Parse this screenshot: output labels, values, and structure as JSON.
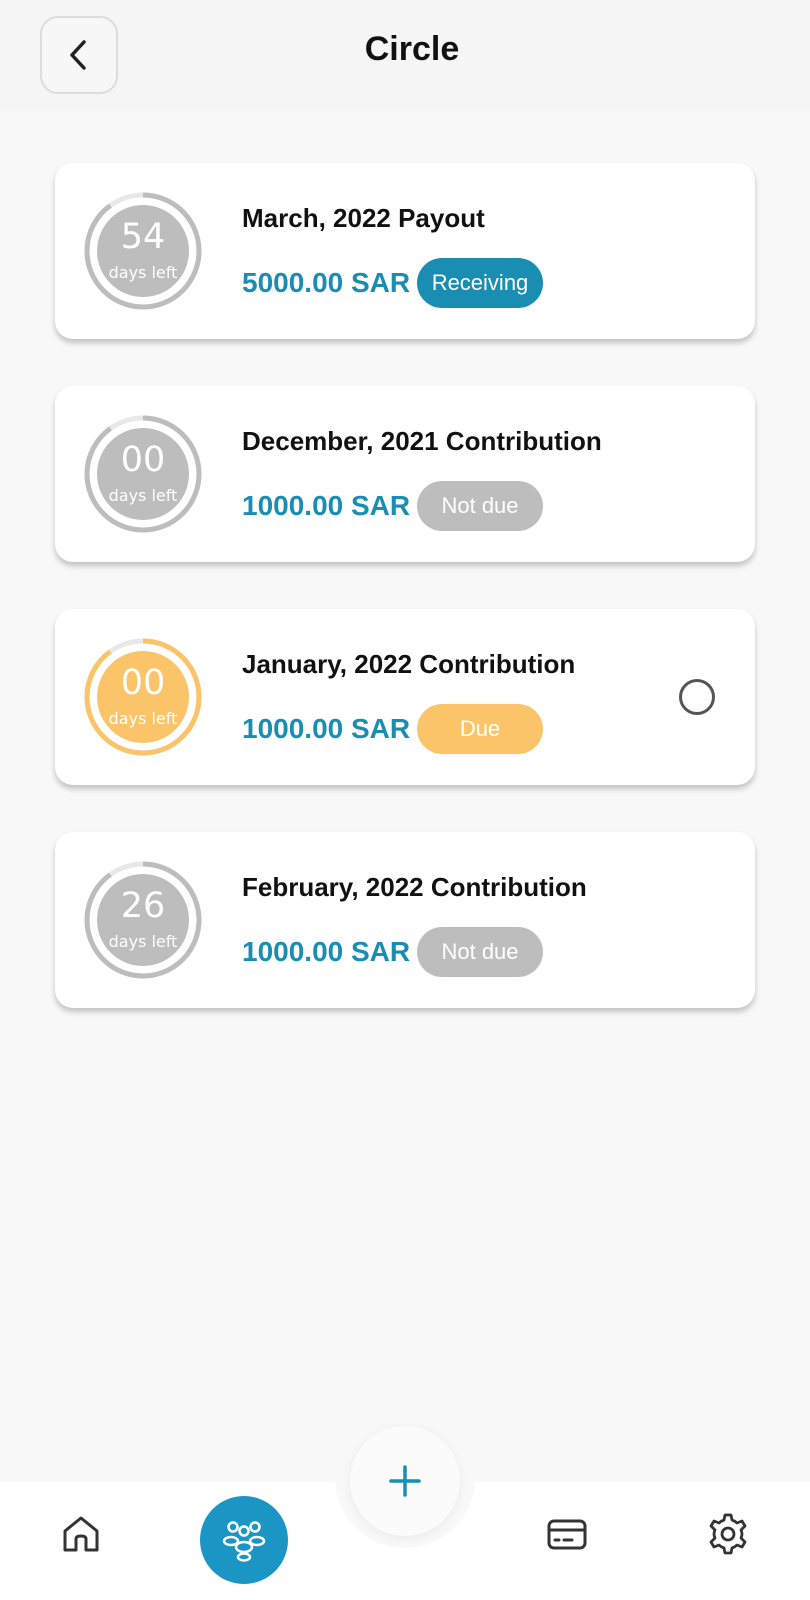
{
  "header": {
    "title": "Circle"
  },
  "colors": {
    "accent": "#1a8db3",
    "receiving": "#1a8db3",
    "not_due": "#bdbdbd",
    "due": "#fbc469",
    "ring_grey": "#bdbdbd",
    "ring_orange": "#fbc469"
  },
  "items": [
    {
      "days": "54",
      "days_label": "days left",
      "title": "March, 2022 Payout",
      "amount": "5000.00 SAR",
      "status": "Receiving",
      "status_color": "#1a8db3",
      "ring_color": "#bdbdbd",
      "ring_progress": 0.9
    },
    {
      "days": "00",
      "days_label": "days left",
      "title": "December, 2021 Contribution",
      "amount": "1000.00 SAR",
      "status": "Not due",
      "status_color": "#bdbdbd",
      "ring_color": "#bdbdbd",
      "ring_progress": 0.9
    },
    {
      "days": "00",
      "days_label": "days left",
      "title": "January, 2022 Contribution",
      "amount": "1000.00 SAR",
      "status": "Due",
      "status_color": "#fbc469",
      "ring_color": "#fbc469",
      "ring_progress": 0.9,
      "has_radio": true
    },
    {
      "days": "26",
      "days_label": "days left",
      "title": "February, 2022 Contribution",
      "amount": "1000.00 SAR",
      "status": "Not due",
      "status_color": "#bdbdbd",
      "ring_color": "#bdbdbd",
      "ring_progress": 0.9
    }
  ],
  "nav": {
    "items": [
      {
        "icon": "home-icon"
      },
      {
        "icon": "group-icon",
        "active": true
      },
      {
        "icon": "plus-icon"
      },
      {
        "icon": "card-icon"
      },
      {
        "icon": "gear-icon"
      }
    ]
  }
}
